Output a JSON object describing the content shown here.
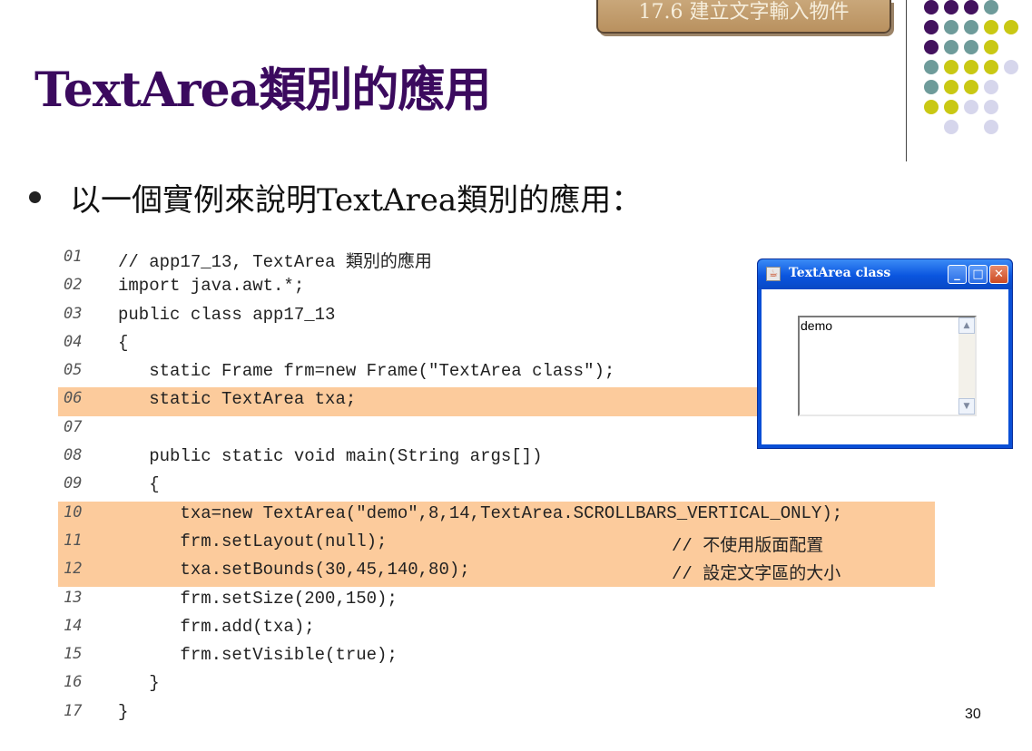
{
  "section_tab": "17.6 建立文字輸入物件",
  "title": "TextArea類別的應用",
  "bullet": "以一個實例來說明TextArea類別的應用：",
  "colors": {
    "title": "#3b0a5e",
    "highlight": "#fccb9c",
    "tab": "#b9915f"
  },
  "code": [
    {
      "num": "01",
      "text": "// app17_13, TextArea 類別的應用",
      "comment": "",
      "highlight": false
    },
    {
      "num": "02",
      "text": "import java.awt.*;",
      "comment": "",
      "highlight": false
    },
    {
      "num": "03",
      "text": "public class app17_13",
      "comment": "",
      "highlight": false
    },
    {
      "num": "04",
      "text": "{",
      "comment": "",
      "highlight": false
    },
    {
      "num": "05",
      "text": "   static Frame frm=new Frame(\"TextArea class\");",
      "comment": "",
      "highlight": false
    },
    {
      "num": "06",
      "text": "   static TextArea txa;",
      "comment": "",
      "highlight": true
    },
    {
      "num": "07",
      "text": "",
      "comment": "",
      "highlight": false
    },
    {
      "num": "08",
      "text": "   public static void main(String args[])",
      "comment": "",
      "highlight": false
    },
    {
      "num": "09",
      "text": "   {",
      "comment": "",
      "highlight": false
    },
    {
      "num": "10",
      "text": "      txa=new TextArea(\"demo\",8,14,TextArea.SCROLLBARS_VERTICAL_ONLY);",
      "comment": "",
      "highlight": true
    },
    {
      "num": "11",
      "text": "      frm.setLayout(null);",
      "comment": "// 不使用版面配置",
      "highlight": true
    },
    {
      "num": "12",
      "text": "      txa.setBounds(30,45,140,80);",
      "comment": "// 設定文字區的大小",
      "highlight": true
    },
    {
      "num": "13",
      "text": "      frm.setSize(200,150);",
      "comment": "",
      "highlight": false
    },
    {
      "num": "14",
      "text": "      frm.add(txa);",
      "comment": "",
      "highlight": false
    },
    {
      "num": "15",
      "text": "      frm.setVisible(true);",
      "comment": "",
      "highlight": false
    },
    {
      "num": "16",
      "text": "   }",
      "comment": "",
      "highlight": false
    },
    {
      "num": "17",
      "text": "}",
      "comment": "",
      "highlight": false
    }
  ],
  "window": {
    "title": "TextArea class",
    "textarea_value": "demo",
    "icons": {
      "app": "java-cup-icon",
      "minimize": "minimize-icon",
      "maximize": "maximize-icon",
      "close": "close-icon"
    }
  },
  "page_number": "30"
}
